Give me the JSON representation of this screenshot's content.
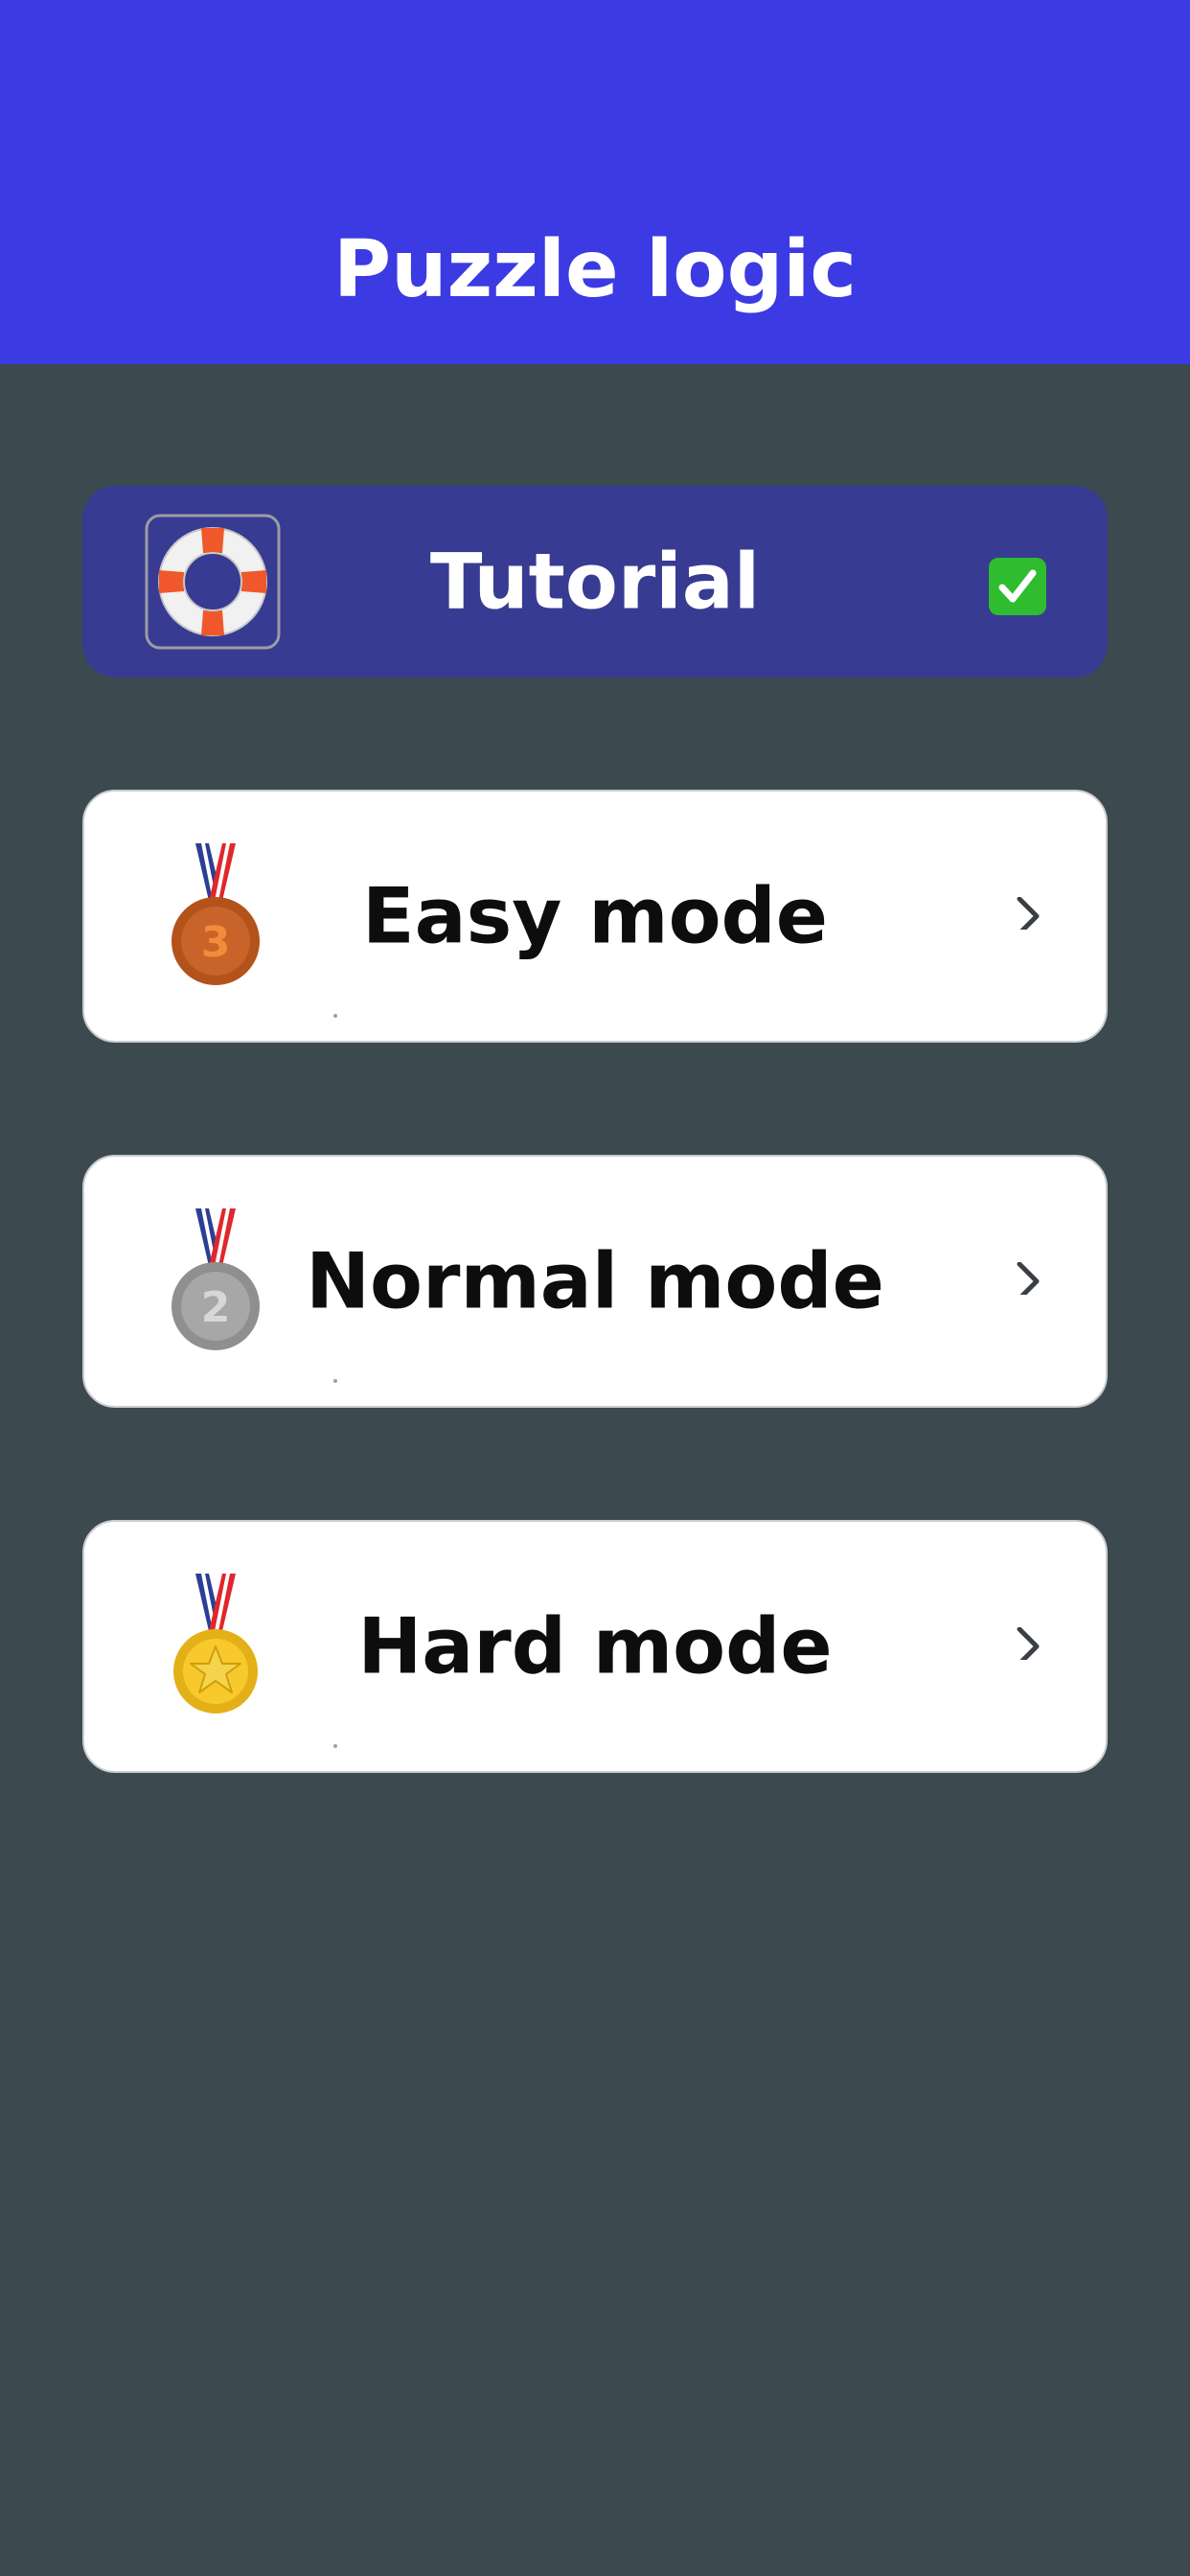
{
  "header": {
    "title": "Puzzle logic",
    "color": "#3b3ae3"
  },
  "menu": {
    "tutorial": {
      "label": "Tutorial",
      "icon": "lifebuoy-icon",
      "status_icon": "check-mark-icon",
      "completed": true,
      "color": "#373b91"
    },
    "modes": [
      {
        "label": "Easy mode",
        "icon": "bronze-medal-icon",
        "medal_number": "3"
      },
      {
        "label": "Normal mode",
        "icon": "silver-medal-icon",
        "medal_number": "2"
      },
      {
        "label": "Hard mode",
        "icon": "gold-medal-icon"
      }
    ]
  },
  "colors": {
    "background": "#3c4a4f",
    "card": "#ffffff",
    "check": "#2fbd2f"
  }
}
